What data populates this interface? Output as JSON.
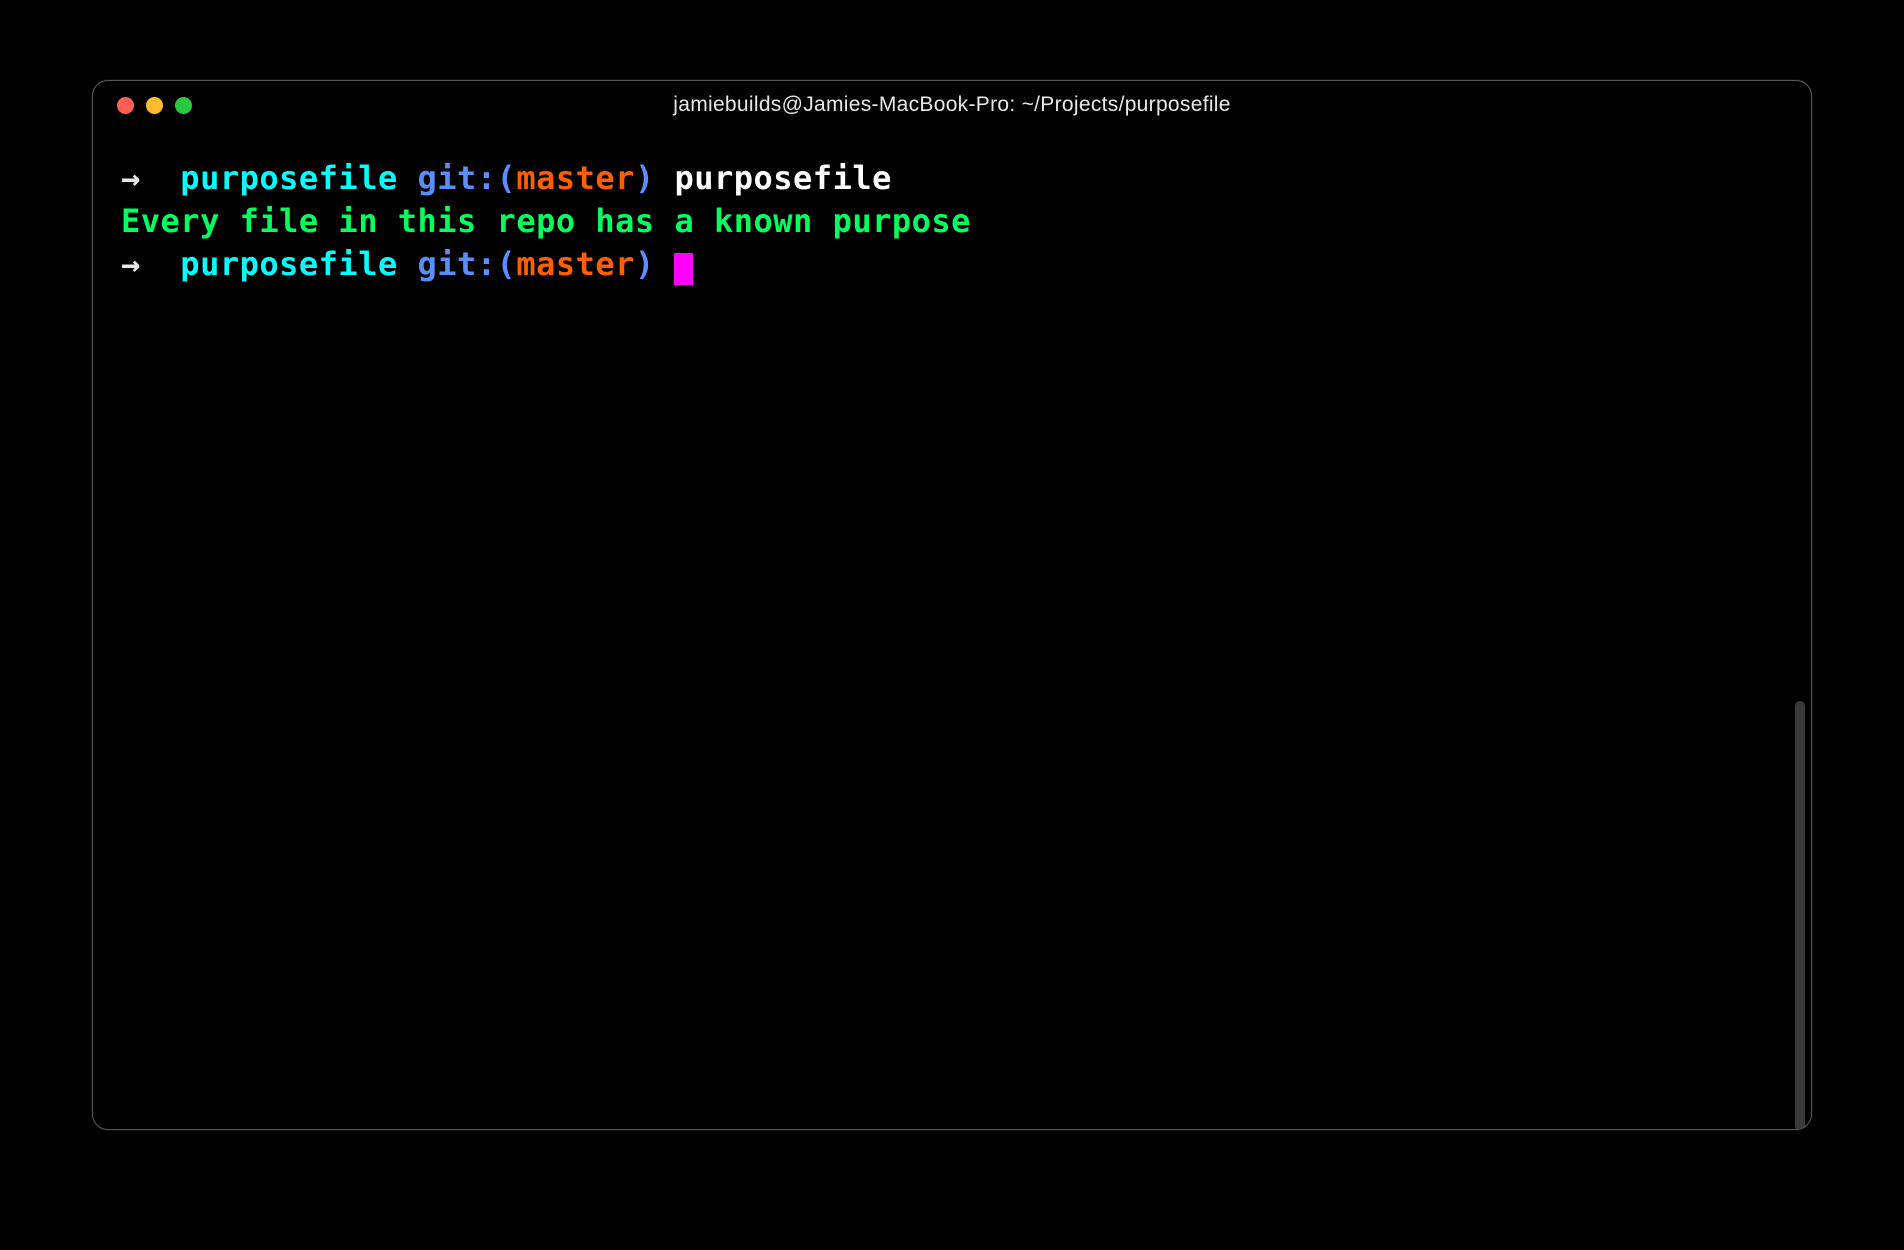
{
  "window": {
    "title": "jamiebuilds@Jamies-MacBook-Pro: ~/Projects/purposefile"
  },
  "prompt": {
    "arrow": "→",
    "directory": "purposefile",
    "git_label": "git:",
    "paren_open": "(",
    "branch": "master",
    "paren_close": ")"
  },
  "lines": {
    "command": "purposefile",
    "output": "Every file in this repo has a known purpose"
  },
  "colors": {
    "cyan": "#00ffff",
    "blue": "#5b8dff",
    "orange": "#ff5f00",
    "green": "#00ff5f",
    "white": "#ffffff",
    "cursor": "#ff00ff"
  }
}
